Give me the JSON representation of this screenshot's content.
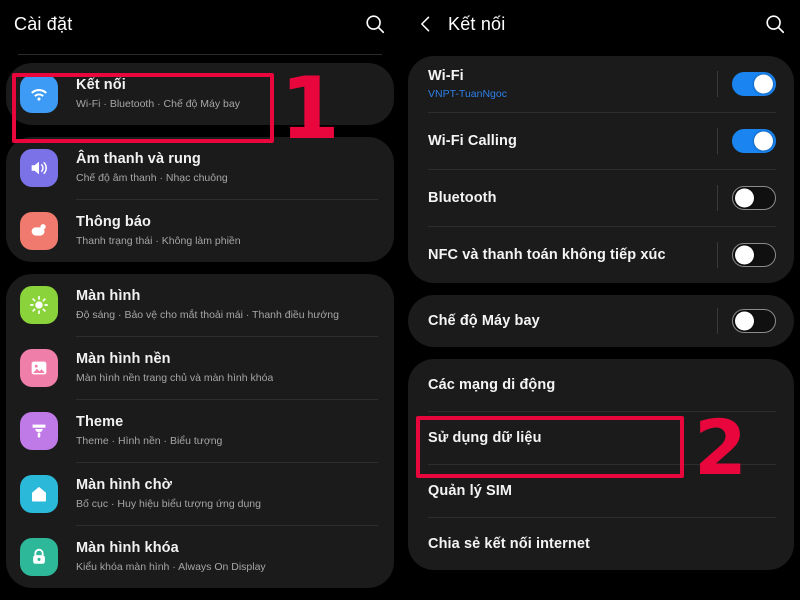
{
  "left_panel": {
    "header": {
      "title": "Cài đặt",
      "search_icon": "search-icon"
    },
    "groups": [
      {
        "items": [
          {
            "title": "Kết nối",
            "subtitle": "Wi-Fi  ·  Bluetooth  ·  Chế độ Máy bay",
            "icon": "wifi-icon",
            "icon_color": "#3d9bf5"
          }
        ]
      },
      {
        "items": [
          {
            "title": "Âm thanh và rung",
            "subtitle": "Chế độ âm thanh  ·  Nhạc chuông",
            "icon": "speaker-icon",
            "icon_color": "#7b72e8"
          },
          {
            "title": "Thông báo",
            "subtitle": "Thanh trạng thái  ·  Không làm phiền",
            "icon": "notification-icon",
            "icon_color": "#ef7a6d"
          }
        ]
      },
      {
        "items": [
          {
            "title": "Màn hình",
            "subtitle": "Độ sáng  ·  Bảo vệ cho mắt thoải mái  ·  Thanh điều hướng",
            "icon": "brightness-icon",
            "icon_color": "#8ad33a"
          },
          {
            "title": "Màn hình nền",
            "subtitle": "Màn hình nền trang chủ và màn hình khóa",
            "icon": "wallpaper-icon",
            "icon_color": "#ef7fa8"
          },
          {
            "title": "Theme",
            "subtitle": "Theme  ·  Hình nền  ·  Biểu tượng",
            "icon": "paintbrush-icon",
            "icon_color": "#c07ae8"
          },
          {
            "title": "Màn hình chờ",
            "subtitle": "Bố cục  ·  Huy hiệu biểu tượng ứng dụng",
            "icon": "home-icon",
            "icon_color": "#2bb9da"
          },
          {
            "title": "Màn hình khóa",
            "subtitle": "Kiểu khóa màn hình  ·  Always On Display",
            "icon": "lock-icon",
            "icon_color": "#2eb89a"
          }
        ]
      }
    ]
  },
  "right_panel": {
    "header": {
      "title": "Kết nối",
      "back_icon": "chevron-left-icon",
      "search_icon": "search-icon"
    },
    "groups": [
      {
        "type": "toggles",
        "items": [
          {
            "title": "Wi-Fi",
            "subtitle": "VNPT-TuanNgoc",
            "toggle": "on"
          },
          {
            "title": "Wi-Fi Calling",
            "subtitle": "",
            "toggle": "on"
          },
          {
            "title": "Bluetooth",
            "subtitle": "",
            "toggle": "off"
          },
          {
            "title": "NFC và thanh toán không tiếp xúc",
            "subtitle": "",
            "toggle": "off"
          }
        ]
      },
      {
        "type": "toggles",
        "items": [
          {
            "title": "Chế độ Máy bay",
            "subtitle": "",
            "toggle": "off"
          }
        ]
      },
      {
        "type": "nav",
        "items": [
          {
            "title": "Các mạng di động"
          },
          {
            "title": "Sử dụng dữ liệu"
          },
          {
            "title": "Quản lý SIM"
          },
          {
            "title": "Chia sẻ kết nối internet"
          }
        ]
      }
    ]
  },
  "annotations": {
    "color": "#e8063c",
    "step_1": {
      "label": "1",
      "target": "Kết nối"
    },
    "step_2": {
      "label": "2",
      "target": "Sử dụng dữ liệu"
    }
  }
}
